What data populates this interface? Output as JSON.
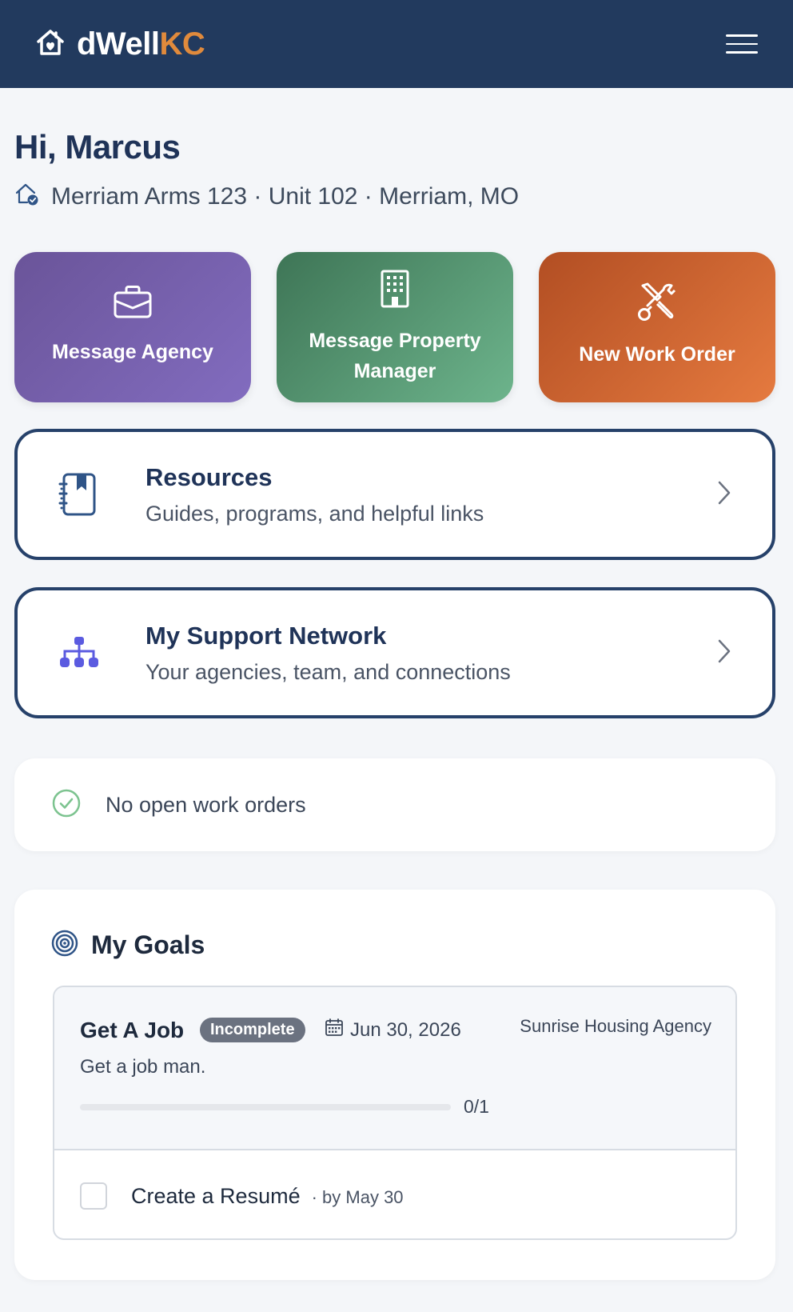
{
  "header": {
    "brand_prefix": "dWell",
    "brand_suffix": "KC",
    "logo_icon": "home-heart-icon",
    "menu_icon": "hamburger-icon"
  },
  "greeting": "Hi, Marcus",
  "address": "Merriam Arms 123 · Unit 102 · Merriam, MO",
  "quick_actions": [
    {
      "label": "Message Agency",
      "icon": "briefcase-icon"
    },
    {
      "label": "Message Property Manager",
      "icon": "building-icon"
    },
    {
      "label": "New Work Order",
      "icon": "tools-icon"
    }
  ],
  "links": [
    {
      "title": "Resources",
      "subtitle": "Guides, programs, and helpful links",
      "icon": "journal-bookmark-icon"
    },
    {
      "title": "My Support Network",
      "subtitle": "Your agencies, team, and connections",
      "icon": "network-icon"
    }
  ],
  "work_orders": {
    "status_text": "No open work orders",
    "icon": "check-circle-icon"
  },
  "goals": {
    "title": "My Goals",
    "icon": "target-icon",
    "items": [
      {
        "name": "Get A Job",
        "status": "Incomplete",
        "due_date": "Jun 30, 2026",
        "agency": "Sunrise Housing Agency",
        "description": "Get a job man.",
        "progress_text": "0/1",
        "progress_fraction": 0,
        "tasks": [
          {
            "name": "Create a Resumé",
            "due": "· by May 30",
            "done": false
          }
        ]
      }
    ]
  },
  "colors": {
    "header_bg": "#223a5e",
    "brand_accent": "#e08a3c",
    "purple": "#7461ad",
    "green": "#58a077",
    "orange": "#d66a33",
    "navy": "#1f3358"
  }
}
